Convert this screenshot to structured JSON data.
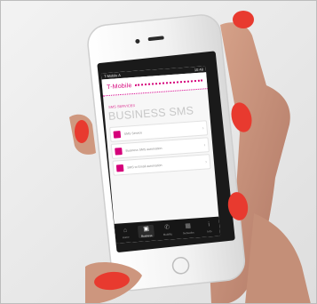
{
  "status_bar": {
    "carrier": "T-Mobile A",
    "time": "10:48"
  },
  "app": {
    "brand": "T-Mobile",
    "subtitle": "SMS services",
    "title": "BUSINESS SMS"
  },
  "menu_items": [
    {
      "label": "SMS Service",
      "icon": "message-icon"
    },
    {
      "label": "Business SMS automation",
      "icon": "message-icon"
    },
    {
      "label": "SMS to Email automation",
      "icon": "message-icon"
    }
  ],
  "tabbar": [
    {
      "label": "Home",
      "icon": "home-icon",
      "active": false
    },
    {
      "label": "Business",
      "icon": "briefcase-icon",
      "active": true
    },
    {
      "label": "Mobility",
      "icon": "phone-icon",
      "active": false
    },
    {
      "label": "Networks",
      "icon": "network-icon",
      "active": false
    },
    {
      "label": "Info",
      "icon": "info-icon",
      "active": false
    }
  ],
  "colors": {
    "brand_magenta": "#d5007a",
    "phone_frame": "#f4f4f4",
    "background": "#ececec",
    "nail_red": "#e83a2f",
    "skin": "#c89078"
  }
}
